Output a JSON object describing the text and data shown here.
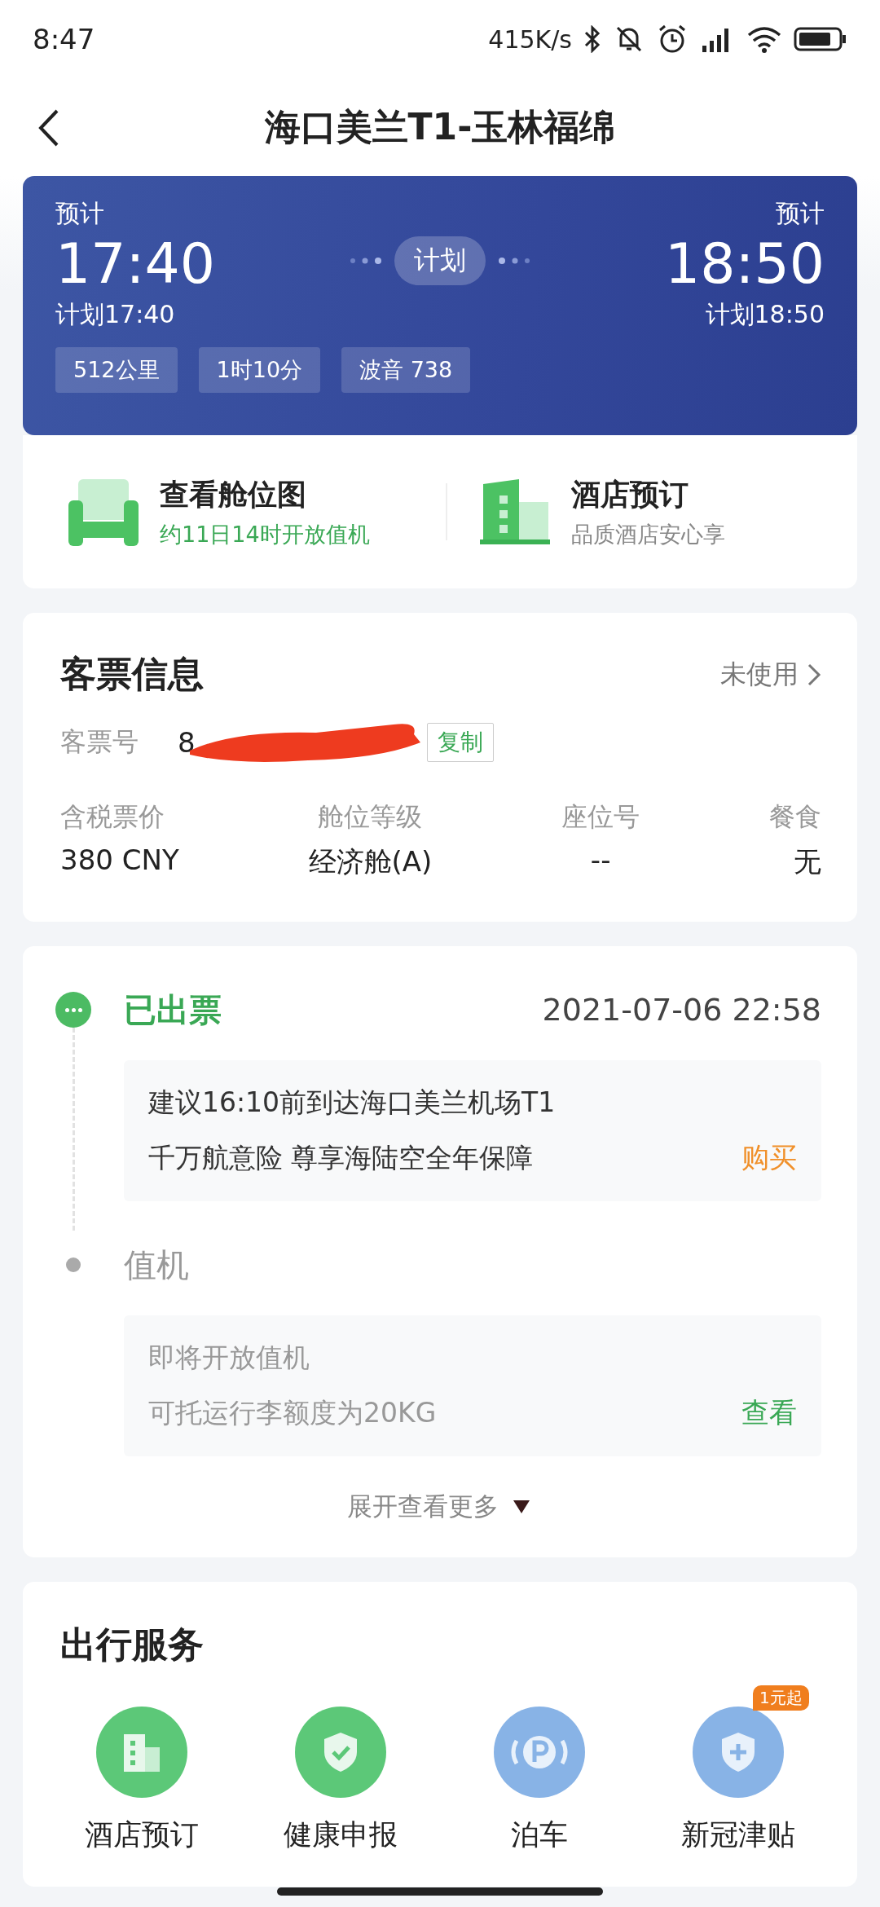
{
  "status_bar": {
    "time": "8:47",
    "speed": "415K/s"
  },
  "header": {
    "title": "海口美兰T1-玉林福绵"
  },
  "flight": {
    "dep": {
      "label": "预计",
      "time": "17:40",
      "planned": "计划17:40"
    },
    "arr": {
      "label": "预计",
      "time": "18:50",
      "planned": "计划18:50"
    },
    "status": "计划",
    "tags": [
      "512公里",
      "1时10分",
      "波音 738"
    ]
  },
  "quick_actions": [
    {
      "kind": "seat",
      "title": "查看舱位图",
      "subtitle": "约11日14时开放值机",
      "accent": true
    },
    {
      "kind": "hotel",
      "title": "酒店预订",
      "subtitle": "品质酒店安心享",
      "accent": false
    }
  ],
  "ticket": {
    "title": "客票信息",
    "status": "未使用",
    "number_label": "客票号",
    "number": "8",
    "copy": "复制",
    "fields": [
      {
        "label": "含税票价",
        "value": "380 CNY"
      },
      {
        "label": "舱位等级",
        "value": "经济舱(A)"
      },
      {
        "label": "座位号",
        "value": "--"
      },
      {
        "label": "餐食",
        "value": "无"
      }
    ]
  },
  "timeline": {
    "steps": [
      {
        "title": "已出票",
        "time": "2021-07-06 22:58",
        "done": true,
        "lines": [
          "建议16:10前到达海口美兰机场T1",
          "千万航意险 尊享海陆空全年保障"
        ],
        "action": "购买"
      },
      {
        "title": "值机",
        "done": false,
        "lines": [
          "即将开放值机",
          "可托运行李额度为20KG"
        ],
        "action": "查看"
      }
    ],
    "more": "展开查看更多"
  },
  "services": {
    "title": "出行服务",
    "items": [
      {
        "kind": "hotel",
        "label": "酒店预订",
        "color": "#5cc878"
      },
      {
        "kind": "health",
        "label": "健康申报",
        "color": "#5cc878"
      },
      {
        "kind": "parking",
        "label": "泊车",
        "color": "#88b3e6"
      },
      {
        "kind": "covid",
        "label": "新冠津贴",
        "color": "#88b3e6",
        "badge": "1元起"
      }
    ]
  }
}
